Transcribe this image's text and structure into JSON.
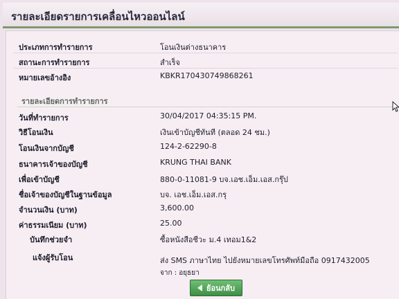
{
  "header": {
    "title": "รายละเอียดรายการเคลื่อนไหวออนไลน์"
  },
  "summary": [
    {
      "label": "ประเภทการทำรายการ",
      "value": "โอนเงินต่างธนาคาร"
    },
    {
      "label": "สถานะการทำรายการ",
      "value": "สำเร็จ"
    },
    {
      "label": "หมายเลขอ้างอิง",
      "value": "KBKR170430749868261"
    }
  ],
  "details_section": {
    "title": "รายละเอียดการทำรายการ"
  },
  "details": [
    {
      "label": "วันที่ทำรายการ",
      "value": "30/04/2017 04:35:15 PM."
    },
    {
      "label": "วิธีโอนเงิน",
      "value": "เงินเข้าบัญชีทันที (ตลอด 24 ชม.)"
    },
    {
      "label": "โอนเงินจากบัญชี",
      "value": "124-2-62290-8"
    },
    {
      "label": "ธนาคารเจ้าของบัญชี",
      "value": "KRUNG THAI BANK"
    },
    {
      "label": "เพื่อเข้าบัญชี",
      "value": "880-0-11081-9 บจ.เอช.เอ็ม.เอส.กรุ๊ป"
    },
    {
      "label": "ชื่อเจ้าของบัญชีในฐานข้อมูล",
      "value": "บจ. เอช.เอ็ม.เอส.กรุ"
    },
    {
      "label": "จำนวนเงิน (บาท)",
      "value": "3,600.00"
    },
    {
      "label": "ค่าธรรมเนียม (บาท)",
      "value": "25.00"
    },
    {
      "label": "บันทึกช่วยจำ",
      "value": "ซื้อหนังสือชีวะ ม.4 เทอม1&2"
    }
  ],
  "notify": {
    "label": "แจ้งผู้รับโอน",
    "value": "ส่ง SMS ภาษาไทย ไปยังหมายเลขโทรศัพท์มือถือ 0917432005",
    "from": "จาก : อยุธยา"
  },
  "back_button": {
    "label": "ย้อนกลับ"
  }
}
